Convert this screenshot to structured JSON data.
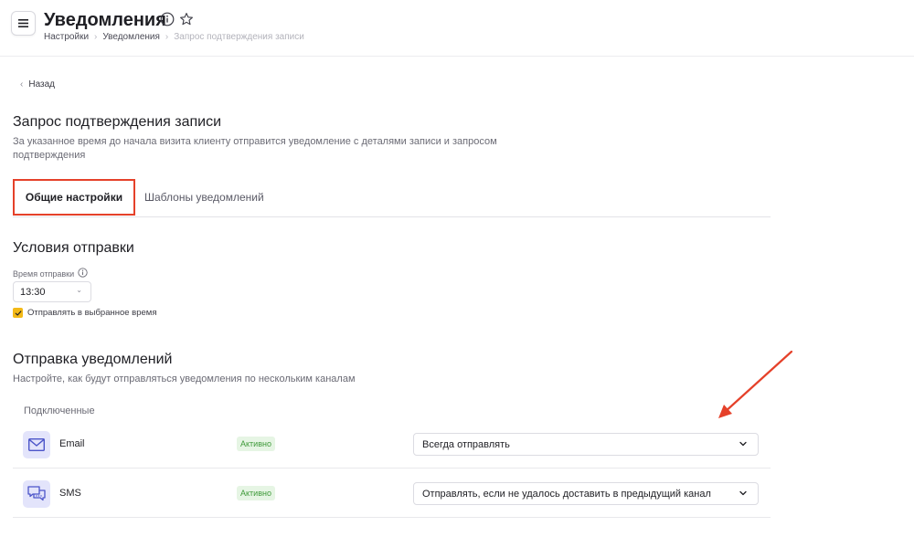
{
  "header": {
    "title": "Уведомления",
    "breadcrumb": [
      "Настройки",
      "Уведомления",
      "Запрос подтверждения записи"
    ],
    "icons": [
      "menu-icon",
      "info-icon",
      "star-icon"
    ]
  },
  "back_label": "Назад",
  "section": {
    "title": "Запрос подтверждения записи",
    "description": "За указанное время до начала визита клиенту отправится уведомление с деталями записи и запросом подтверждения"
  },
  "tabs": [
    {
      "label": "Общие настройки",
      "active": true
    },
    {
      "label": "Шаблоны уведомлений",
      "active": false
    }
  ],
  "conditions": {
    "title": "Условия отправки",
    "time_label": "Время отправки",
    "time_value": "13:30",
    "checkbox_label": "Отправлять в выбранное время",
    "checkbox_checked": true
  },
  "notifications": {
    "title": "Отправка уведомлений",
    "description": "Настройте, как будут отправляться уведомления по нескольким каналам",
    "connected_label": "Подключенные",
    "channels": [
      {
        "name": "Email",
        "icon": "envelope-icon",
        "status": "Активно",
        "mode": "Всегда отправлять"
      },
      {
        "name": "SMS",
        "icon": "chat-icon",
        "status": "Активно",
        "mode": "Отправлять, если не удалось доставить в предыдущий канал"
      }
    ]
  },
  "colors": {
    "highlight": "#e5412a",
    "checkbox": "#f3b917",
    "status_bg": "#e6f5e4",
    "status_text": "#3f9a3a",
    "channel_icon_bg": "#e3e4fb",
    "channel_icon_fg": "#4c55c9"
  }
}
